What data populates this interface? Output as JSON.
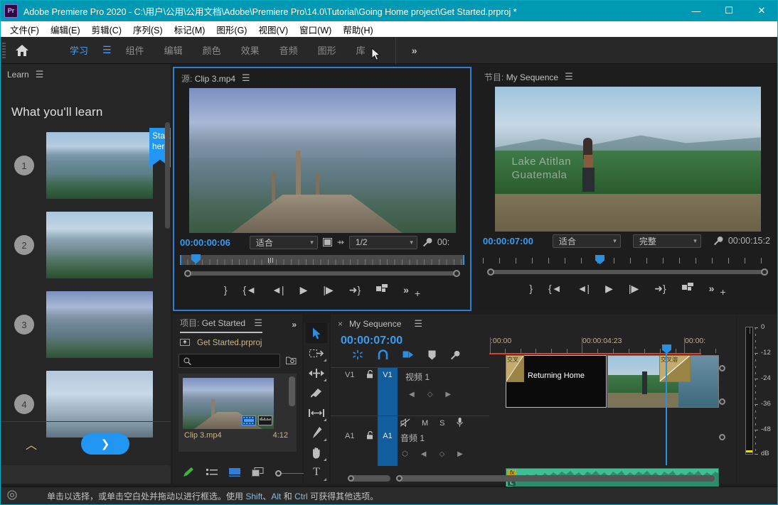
{
  "window": {
    "app_badge": "Pr",
    "title": "Adobe Premiere Pro 2020 - C:\\用户\\公用\\公用文档\\Adobe\\Premiere Pro\\14.0\\Tutorial\\Going Home project\\Get Started.prproj *",
    "minimize": "—",
    "maximize": "☐",
    "close": "✕",
    "accent": "#0099b4"
  },
  "menubar": {
    "items": [
      "文件(F)",
      "编辑(E)",
      "剪辑(C)",
      "序列(S)",
      "标记(M)",
      "图形(G)",
      "视图(V)",
      "窗口(W)",
      "帮助(H)"
    ]
  },
  "workspace": {
    "home_icon": "home-icon",
    "tabs": [
      {
        "label": "学习",
        "active": true
      },
      {
        "label": "组件",
        "active": false
      },
      {
        "label": "编辑",
        "active": false
      },
      {
        "label": "颜色",
        "active": false
      },
      {
        "label": "效果",
        "active": false
      },
      {
        "label": "音频",
        "active": false
      },
      {
        "label": "图形",
        "active": false
      },
      {
        "label": "库",
        "active": false
      }
    ],
    "overflow": "»",
    "active_accent": "#4a9eff"
  },
  "learn_panel": {
    "title": "Learn",
    "heading": "What you'll learn",
    "ribbon_text": "Start here",
    "steps": [
      {
        "number": "1",
        "image": "lake-aerial-thumbnail"
      },
      {
        "number": "2",
        "image": "woman-lake-thumbnail"
      },
      {
        "number": "3",
        "image": "dock-pier-thumbnail"
      },
      {
        "number": "4",
        "image": "misty-lake-thumbnail"
      }
    ],
    "collapse_icon": "chevron-up-icon",
    "next_label": "❯"
  },
  "source_monitor": {
    "label": "源",
    "clip_name": "Clip 3.mp4",
    "burger": "☰",
    "timecode_in": "00:00:00:06",
    "fit_value": "适合",
    "quality_value": "1/2",
    "export_frame_icon": "camera-icon",
    "settings_icon": "wrench-icon",
    "timecode_out": "00:",
    "transport": [
      {
        "name": "mark-in-out",
        "glyph": "}"
      },
      {
        "name": "go-to-in",
        "glyph": "{◄"
      },
      {
        "name": "step-back",
        "glyph": "◄|"
      },
      {
        "name": "play",
        "glyph": "▶"
      },
      {
        "name": "step-forward",
        "glyph": "|▶"
      },
      {
        "name": "go-to-out",
        "glyph": "➜}"
      },
      {
        "name": "insert",
        "glyph": "⎚"
      },
      {
        "name": "overflow",
        "glyph": "»"
      },
      {
        "name": "button-editor",
        "glyph": "+"
      }
    ]
  },
  "program_monitor": {
    "label": "节目",
    "sequence_name": "My Sequence",
    "burger": "☰",
    "watermark_line1": "Lake Atitlan",
    "watermark_line2": "Guatemala",
    "timecode_current": "00:00:07:00",
    "fit_value": "适合",
    "resolution_value": "完整",
    "settings_icon": "wrench-icon",
    "duration": "00:00:15:2"
  },
  "project_panel": {
    "label": "项目",
    "name": "Get Started",
    "burger": "☰",
    "overflow": "»",
    "parent_icon": "up-folder-icon",
    "project_file": "Get Started.prproj",
    "search_placeholder": "",
    "search_value": "",
    "find_icon": "find-icon",
    "items": [
      {
        "name": "Clip 3.mp4",
        "duration": "4:12",
        "thumbnail": "dock-pier-thumbnail",
        "badges": [
          "video-badge",
          "audio-badge"
        ]
      }
    ],
    "footer_icons": [
      "new-item-pen-icon",
      "list-view-icon",
      "icon-view-icon",
      "freeform-view-icon",
      "zoom-slider-icon"
    ]
  },
  "tools": [
    {
      "name": "selection-tool",
      "glyph": "➤",
      "active": true
    },
    {
      "name": "track-select-forward-tool",
      "glyph": "⇢",
      "active": false
    },
    {
      "name": "ripple-edit-tool",
      "glyph": "↔",
      "active": false
    },
    {
      "name": "razor-tool",
      "glyph": "◣",
      "active": false
    },
    {
      "name": "slip-tool",
      "glyph": "|↔|",
      "active": false
    },
    {
      "name": "pen-tool",
      "glyph": "✒",
      "active": false
    },
    {
      "name": "hand-tool",
      "glyph": "✋",
      "active": false
    },
    {
      "name": "type-tool",
      "glyph": "T",
      "active": false
    }
  ],
  "timeline": {
    "close_glyph": "×",
    "sequence_name": "My Sequence",
    "burger": "☰",
    "playhead_timecode": "00:00:07:00",
    "toggles": [
      {
        "name": "insert-overwrite-sequence-icon",
        "glyph": "✸"
      },
      {
        "name": "snap-icon",
        "glyph": "∩"
      },
      {
        "name": "linked-selection-icon",
        "glyph": "⯈"
      },
      {
        "name": "add-marker-icon",
        "glyph": "🛡"
      },
      {
        "name": "timeline-settings-icon",
        "glyph": "🔧"
      }
    ],
    "ruler_labels": [
      ":00:00",
      "00:00:04:23",
      "00:00:"
    ],
    "video_tracks": [
      {
        "id": "V1",
        "name": "视频 1",
        "lock_icon": "unlock-icon",
        "nav": [
          "prev-keyframe",
          "add-keyframe",
          "next-keyframe"
        ]
      }
    ],
    "audio_tracks": [
      {
        "id": "A1",
        "name": "音频 1",
        "lock_icon": "unlock-icon",
        "buttons": [
          "mute-icon",
          "M",
          "S",
          "mic-icon"
        ],
        "nav": [
          "prev-keyframe",
          "add-keyframe",
          "next-keyframe"
        ]
      }
    ],
    "clips": [
      {
        "name": "transition-start",
        "label": "交叉",
        "type": "transition"
      },
      {
        "name": "Returning Home",
        "label": "Returning Home",
        "type": "title"
      },
      {
        "name": "video-clip",
        "label": "",
        "type": "video"
      },
      {
        "name": "transition-end",
        "label": "交叉溶",
        "type": "transition"
      },
      {
        "name": "audio-clip",
        "label": "L",
        "type": "audio",
        "badge": "fx"
      }
    ]
  },
  "audio_meter": {
    "scale": [
      "0",
      "-12",
      "-24",
      "-36",
      "-48",
      "dB"
    ],
    "peak_color": "#e8e000"
  },
  "statusbar": {
    "icon": "selection-status-icon",
    "text_parts": [
      {
        "t": "单击以选择，或单击空白处并拖动以进行框选。使用 ",
        "k": false
      },
      {
        "t": "Shift",
        "k": true
      },
      {
        "t": "、",
        "k": false
      },
      {
        "t": "Alt",
        "k": true
      },
      {
        "t": " 和 ",
        "k": false
      },
      {
        "t": "Ctrl",
        "k": true
      },
      {
        "t": " 可获得其他选项。",
        "k": false
      }
    ],
    "full_text": "单击以选择，或单击空白处并拖动以进行框选。使用 Shift、Alt 和 Ctrl 可获得其他选项。"
  }
}
